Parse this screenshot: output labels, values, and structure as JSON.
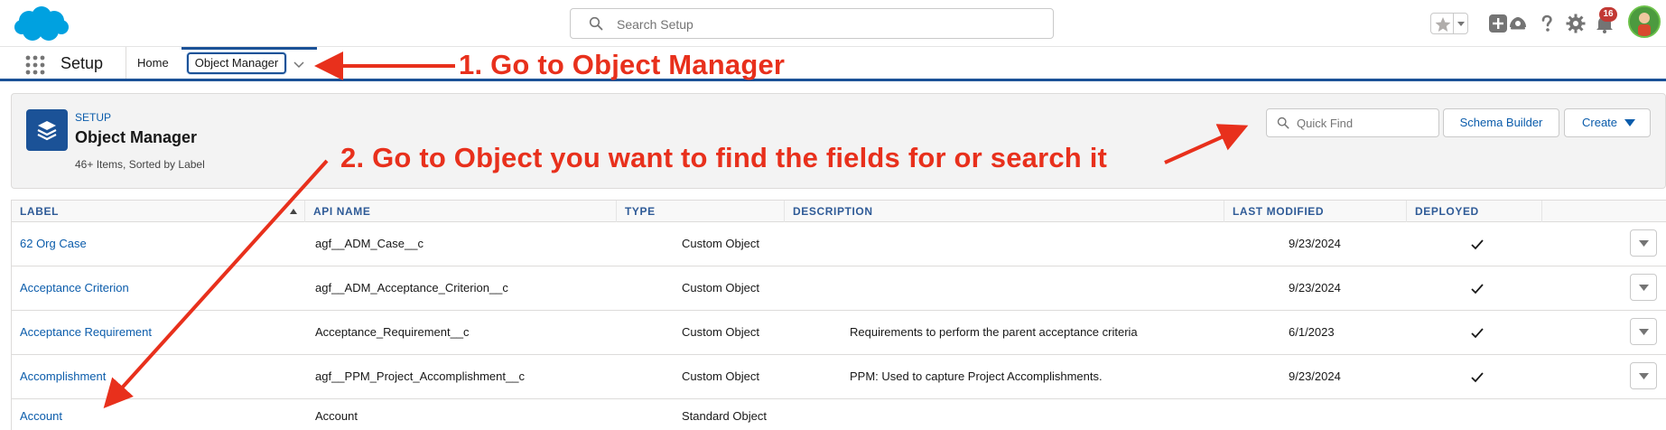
{
  "header": {
    "search_placeholder": "Search Setup",
    "notification_count": "16"
  },
  "context_bar": {
    "app_name": "Setup",
    "tabs": [
      {
        "label": "Home",
        "active": false
      },
      {
        "label": "Object Manager",
        "active": true
      }
    ]
  },
  "object_manager": {
    "eyebrow": "SETUP",
    "title": "Object Manager",
    "meta": "46+ Items, Sorted by Label",
    "quick_find_placeholder": "Quick Find",
    "schema_builder_label": "Schema Builder",
    "create_label": "Create"
  },
  "table": {
    "columns": [
      "LABEL",
      "API NAME",
      "TYPE",
      "DESCRIPTION",
      "LAST MODIFIED",
      "DEPLOYED"
    ],
    "rows": [
      {
        "label": "62 Org Case",
        "api_name": "agf__ADM_Case__c",
        "type": "Custom Object",
        "description": "",
        "last_modified": "9/23/2024",
        "deployed": true
      },
      {
        "label": "Acceptance Criterion",
        "api_name": "agf__ADM_Acceptance_Criterion__c",
        "type": "Custom Object",
        "description": "",
        "last_modified": "9/23/2024",
        "deployed": true
      },
      {
        "label": "Acceptance Requirement",
        "api_name": "Acceptance_Requirement__c",
        "type": "Custom Object",
        "description": "Requirements to perform the parent acceptance criteria",
        "last_modified": "6/1/2023",
        "deployed": true
      },
      {
        "label": "Accomplishment",
        "api_name": "agf__PPM_Project_Accomplishment__c",
        "type": "Custom Object",
        "description": "PPM: Used to capture Project Accomplishments.",
        "last_modified": "9/23/2024",
        "deployed": true
      },
      {
        "label": "Account",
        "api_name": "Account",
        "type": "Standard Object",
        "description": "",
        "last_modified": "",
        "deployed": false
      }
    ]
  },
  "annotations": {
    "step1": "1. Go to Object Manager",
    "step2": "2. Go to Object you want to find the fields for or search it"
  },
  "colors": {
    "brand_blue": "#1b5297",
    "link_blue": "#0b5cab",
    "annotation_red": "#e8301c",
    "salesforce_cloud": "#00a1e0"
  },
  "icons": [
    "salesforce-logo",
    "search-icon",
    "star-icon",
    "add-icon",
    "trailhead-icon",
    "help-icon",
    "gear-icon",
    "bell-icon",
    "app-launcher-icon",
    "layers-icon",
    "check-icon",
    "chevron-down-icon"
  ]
}
